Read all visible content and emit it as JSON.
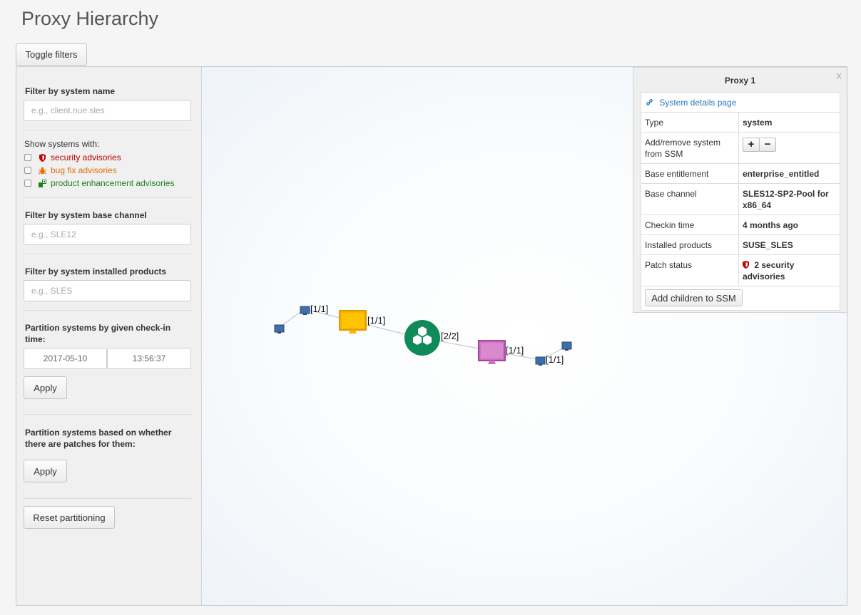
{
  "page": {
    "title": "Proxy Hierarchy"
  },
  "toolbar": {
    "toggle_filters_label": "Toggle filters"
  },
  "filters": {
    "name": {
      "label": "Filter by system name",
      "placeholder": "e.g., client.nue.sles"
    },
    "show_with": {
      "label": "Show systems with:",
      "options": [
        {
          "label": "security advisories",
          "icon": "shield-icon",
          "color": "#c00000"
        },
        {
          "label": "bug fix advisories",
          "icon": "bug-icon",
          "color": "#e07000"
        },
        {
          "label": "product enhancement advisories",
          "icon": "puzzle-icon",
          "color": "#208020"
        }
      ]
    },
    "base_channel": {
      "label": "Filter by system base channel",
      "placeholder": "e.g., SLE12"
    },
    "installed_products": {
      "label": "Filter by system installed products",
      "placeholder": "e.g., SLES"
    },
    "checkin": {
      "label": "Partition systems by given check-in time:",
      "date": "2017-05-10",
      "time": "13:56:37",
      "apply_label": "Apply"
    },
    "patches": {
      "label": "Partition systems based on whether there are patches for them:",
      "apply_label": "Apply"
    },
    "reset_label": "Reset partitioning"
  },
  "graph": {
    "labels": {
      "top_client": "[1/1]",
      "proxy_1": "[1/1]",
      "root": "[2/2]",
      "proxy_2": "[1/1]",
      "bottom_client": "[1/1]"
    },
    "colors": {
      "root": "#108a5b",
      "proxy_1": "#f7b500",
      "proxy_2": "#cf6fc4",
      "client": "#3f6fa8",
      "link": "#c8c8c8"
    }
  },
  "details": {
    "close_label": "X",
    "title": "Proxy 1",
    "link_label": "System details page",
    "rows": {
      "type": {
        "key": "Type",
        "value": "system"
      },
      "ssm": {
        "key": "Add/remove system from SSM",
        "plus": "+",
        "minus": "−"
      },
      "entitlement": {
        "key": "Base entitlement",
        "value": "enterprise_entitled"
      },
      "channel": {
        "key": "Base channel",
        "value": "SLES12-SP2-Pool for x86_64"
      },
      "checkin": {
        "key": "Checkin time",
        "value": "4 months ago"
      },
      "products": {
        "key": "Installed products",
        "value": "SUSE_SLES"
      },
      "patch": {
        "key": "Patch status",
        "value": "2 security advisories"
      }
    },
    "add_children_label": "Add children to SSM"
  }
}
